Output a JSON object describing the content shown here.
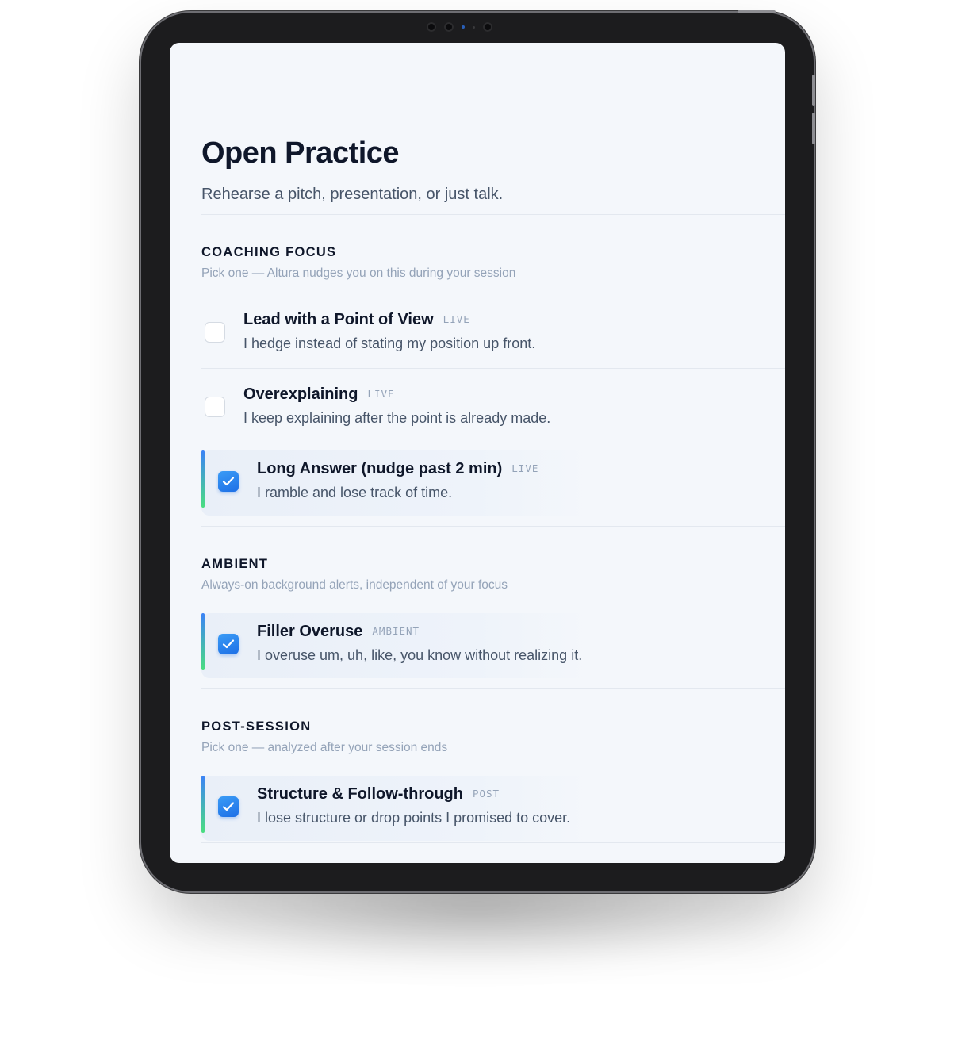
{
  "page": {
    "title": "Open Practice",
    "subtitle": "Rehearse a pitch, presentation, or just talk."
  },
  "sections": {
    "coaching": {
      "title": "COACHING FOCUS",
      "subtitle": "Pick one — Altura nudges you on this during your session",
      "options": [
        {
          "title": "Lead with a Point of View",
          "tag": "LIVE",
          "desc": "I hedge instead of stating my position up front.",
          "checked": false
        },
        {
          "title": "Overexplaining",
          "tag": "LIVE",
          "desc": "I keep explaining after the point is already made.",
          "checked": false
        },
        {
          "title": "Long Answer (nudge past 2 min)",
          "tag": "LIVE",
          "desc": "I ramble and lose track of time.",
          "checked": true
        }
      ]
    },
    "ambient": {
      "title": "AMBIENT",
      "subtitle": "Always-on background alerts, independent of your focus",
      "options": [
        {
          "title": "Filler Overuse",
          "tag": "AMBIENT",
          "desc": "I overuse um, uh, like, you know without realizing it.",
          "checked": true
        }
      ]
    },
    "post": {
      "title": "POST-SESSION",
      "subtitle": "Pick one — analyzed after your session ends",
      "options": [
        {
          "title": "Structure & Follow-through",
          "tag": "POST",
          "desc": "I lose structure or drop points I promised to cover.",
          "checked": true
        }
      ]
    }
  },
  "colors": {
    "accent": "#1d6fe6",
    "accent_gradient_end": "#4ade80",
    "background": "#f4f7fb",
    "text_primary": "#0f172a",
    "text_muted": "#94a3b8"
  },
  "icons": {
    "checkmark": "checkmark-icon"
  }
}
